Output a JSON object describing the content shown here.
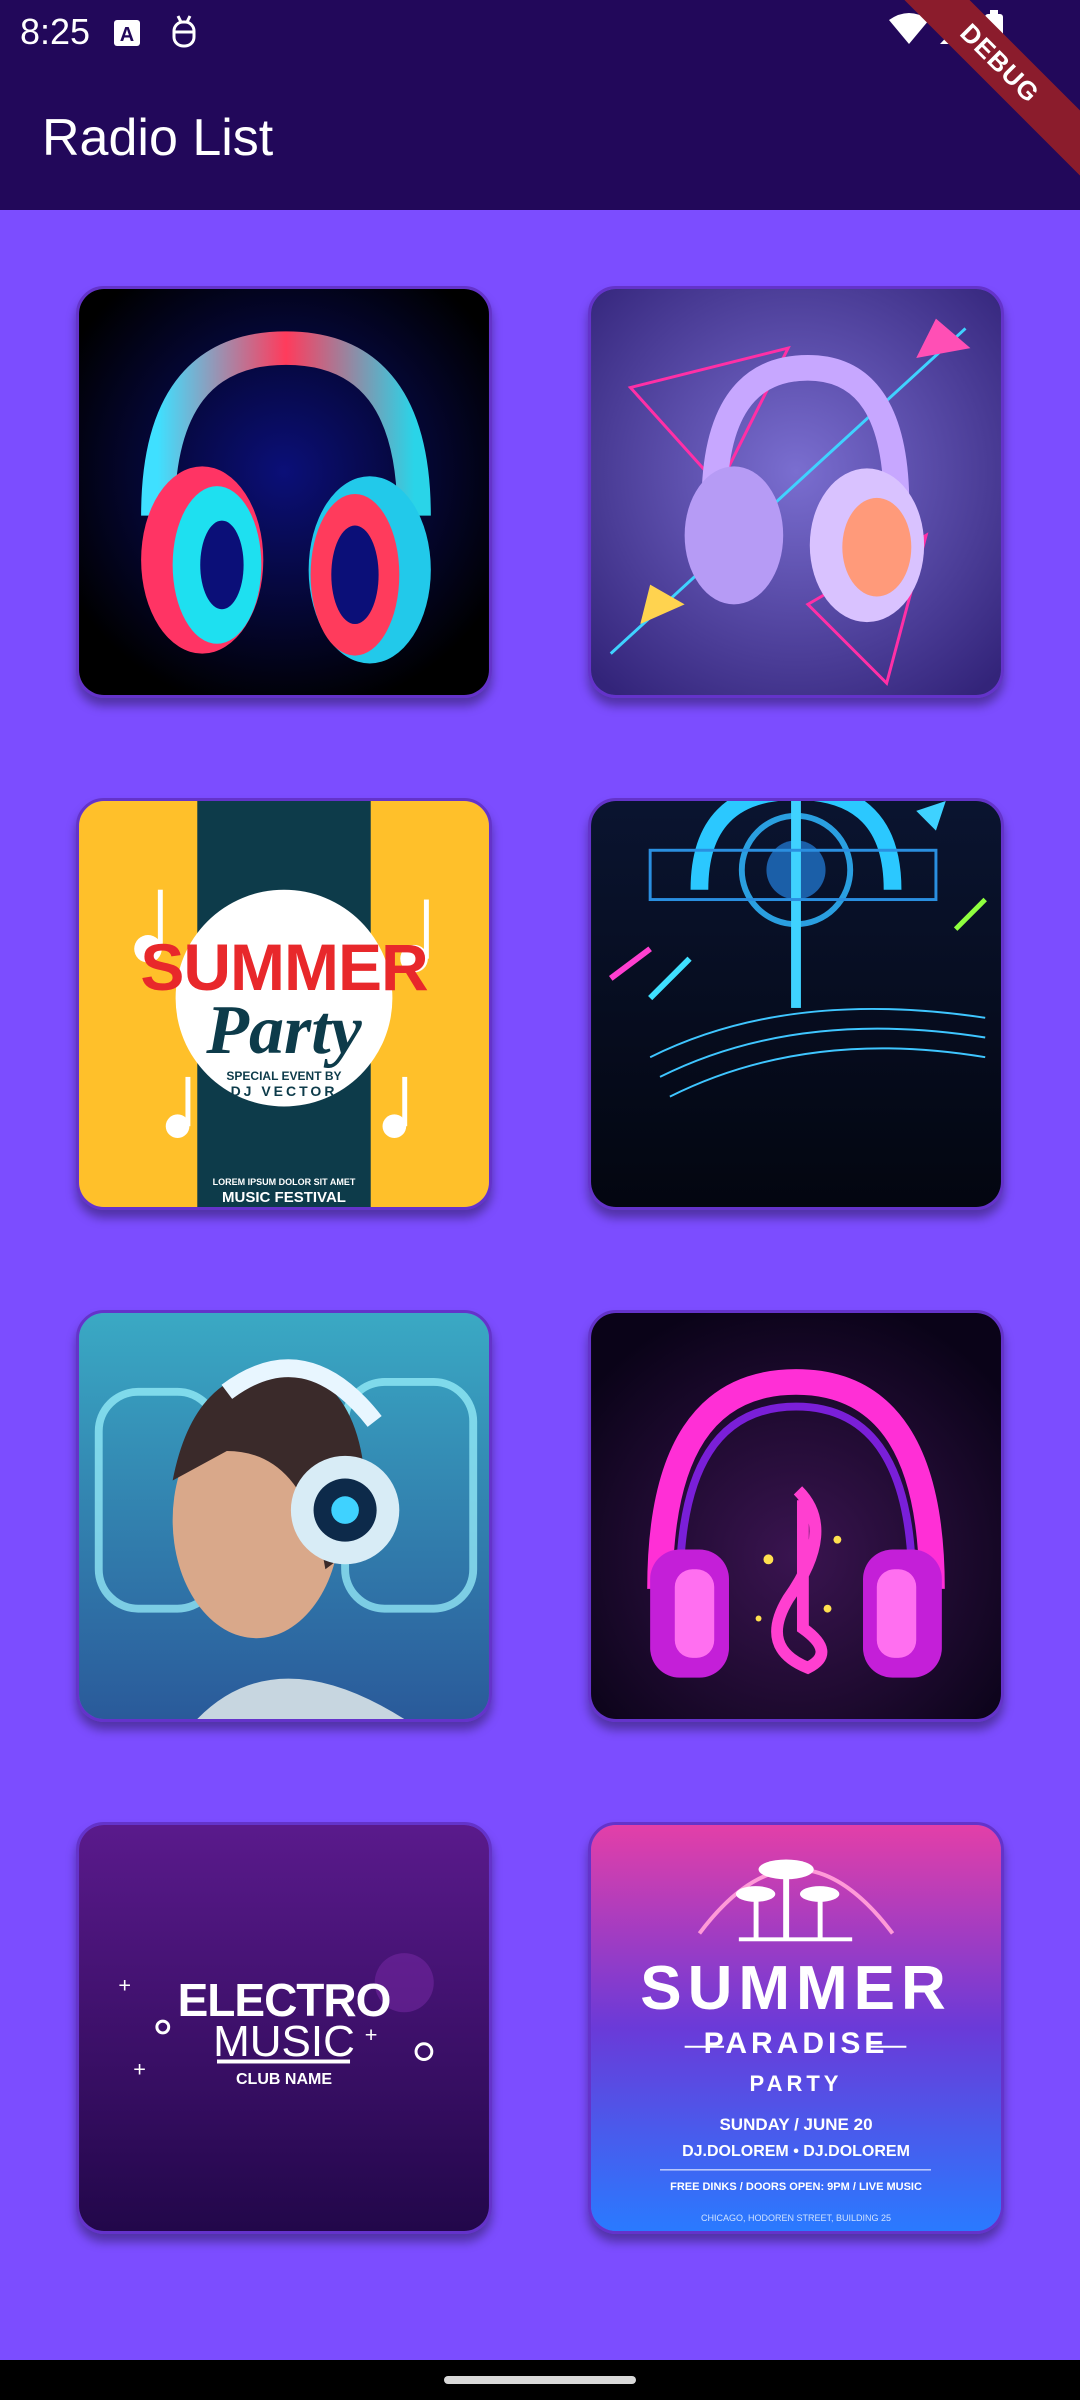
{
  "status_bar": {
    "time": "8:25"
  },
  "app_bar": {
    "title": "Radio List"
  },
  "debug_banner": "DEBUG",
  "stations": [
    {
      "id": "neon-headphones"
    },
    {
      "id": "lilac-headphones"
    },
    {
      "id": "summer-party",
      "line1": "SUMMER",
      "line2": "Party",
      "line3": "SPECIAL EVENT BY",
      "line4": "DJ VECTOR",
      "small": "LOREM IPSUM DOLOR SIT AMET",
      "footer": "MUSIC FESTIVAL"
    },
    {
      "id": "tech-headphones"
    },
    {
      "id": "woman-headphones"
    },
    {
      "id": "magenta-headphones"
    },
    {
      "id": "electro-music",
      "line1": "ELECTRO",
      "line2": "MUSIC",
      "line3": "CLUB NAME"
    },
    {
      "id": "summer-paradise",
      "line1": "SUMMER",
      "line2": "PARADISE",
      "line3": "PARTY",
      "line4": "SUNDAY / JUNE 20",
      "line5": "DJ.DOLOREM • DJ.DOLOREM",
      "line6": "FREE DINKS / DOORS OPEN: 9PM / LIVE MUSIC",
      "line7": "CHICAGO, HODOREN STREET, BUILDING 25"
    }
  ]
}
